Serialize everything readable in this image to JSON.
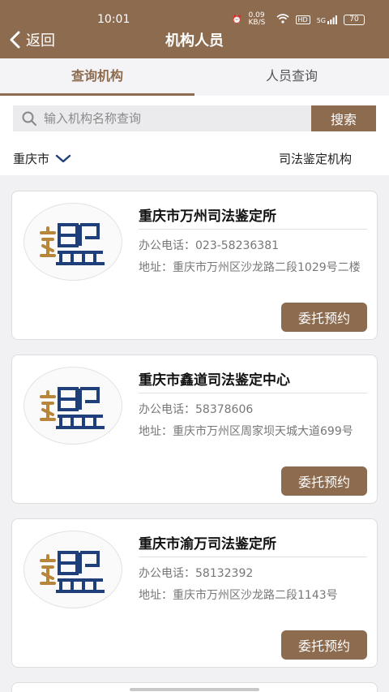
{
  "status": {
    "time": "10:01",
    "net_speed": "0.09 KB/S",
    "hd": "HD",
    "signal": "5G",
    "battery": "70"
  },
  "header": {
    "back_label": "返回",
    "title": "机构人员"
  },
  "tabs": [
    {
      "label": "查询机构",
      "active": true
    },
    {
      "label": "人员查询",
      "active": false
    }
  ],
  "search": {
    "placeholder": "输入机构名称查询",
    "value": "",
    "button_label": "搜索"
  },
  "filters": {
    "city": "重庆市",
    "category": "司法鉴定机构"
  },
  "institutions": [
    {
      "name": "重庆市万州司法鉴定所",
      "phone_label": "办公电话：",
      "phone": "023-58236381",
      "address_label": "地址：",
      "address": "重庆市万州区沙龙路二段1029号二楼",
      "action_label": "委托预约"
    },
    {
      "name": "重庆市鑫道司法鉴定中心",
      "phone_label": "办公电话：",
      "phone": "58378606",
      "address_label": "地址：",
      "address": "重庆市万州区周家坝天城大道699号",
      "action_label": "委托预约"
    },
    {
      "name": "重庆市渝万司法鉴定所",
      "phone_label": "办公电话：",
      "phone": "58132392",
      "address_label": "地址：",
      "address": "重庆市万州区沙龙路二段1143号",
      "action_label": "委托预约"
    }
  ],
  "colors": {
    "brand": "#8d6b4f",
    "logo_blue": "#1f3f7a",
    "logo_gold": "#b8863a"
  }
}
